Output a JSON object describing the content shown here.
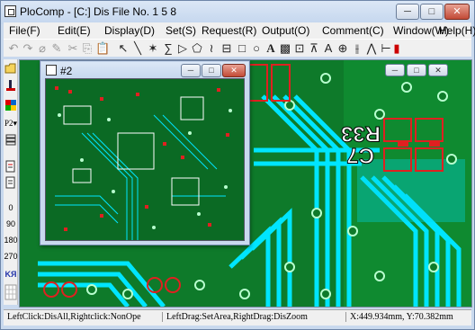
{
  "window": {
    "title": "PloComp - [C:] Dis File No. 1 5 8",
    "controls": {
      "minimize": "─",
      "maximize": "□",
      "close": "✕"
    }
  },
  "menu": [
    {
      "name": "file",
      "label": "File(F)"
    },
    {
      "name": "edit",
      "label": "Edit(E)"
    },
    {
      "name": "display",
      "label": "Display(D)"
    },
    {
      "name": "set",
      "label": "Set(S)"
    },
    {
      "name": "request",
      "label": "Request(R)"
    },
    {
      "name": "output",
      "label": "Output(O)"
    },
    {
      "name": "comment",
      "label": "Comment(C)"
    },
    {
      "name": "window",
      "label": "Window(W)"
    },
    {
      "name": "help",
      "label": "Help(H)"
    }
  ],
  "toolbar": {
    "glyphs": [
      "↶",
      "↷",
      "⌀",
      "✎",
      "✂",
      "⎘",
      "📋",
      "↖",
      "╲",
      "✶",
      "∑",
      "▷",
      "⬠",
      "≀",
      "⊟",
      "□",
      "○",
      "A",
      "▩",
      "⊡",
      "⊼",
      "A",
      "⊕",
      "⫲",
      "⋀",
      "⊢",
      "▮"
    ]
  },
  "lefttoolbar": {
    "rotations": [
      "0",
      "90",
      "180",
      "270"
    ],
    "p2": "P2▾",
    "ky": "KЯ"
  },
  "child": {
    "title": "#2",
    "controls": {
      "minimize": "─",
      "maximize": "□",
      "close": "✕"
    }
  },
  "board": {
    "silkscreen_1": "R33",
    "silkscreen_2": "C7"
  },
  "status": {
    "left": "LeftClick:DisAll,Rightclick:NonOpe",
    "middle": "LeftDrag:SetArea,RightDrag:DisZoom",
    "coords": "X:449.934mm, Y:70.382mm"
  },
  "colors": {
    "board_green": "#0e7a2a",
    "trace_cyan": "#00e5ff",
    "pad_red": "#e02020",
    "silk_white": "#ffffff"
  }
}
